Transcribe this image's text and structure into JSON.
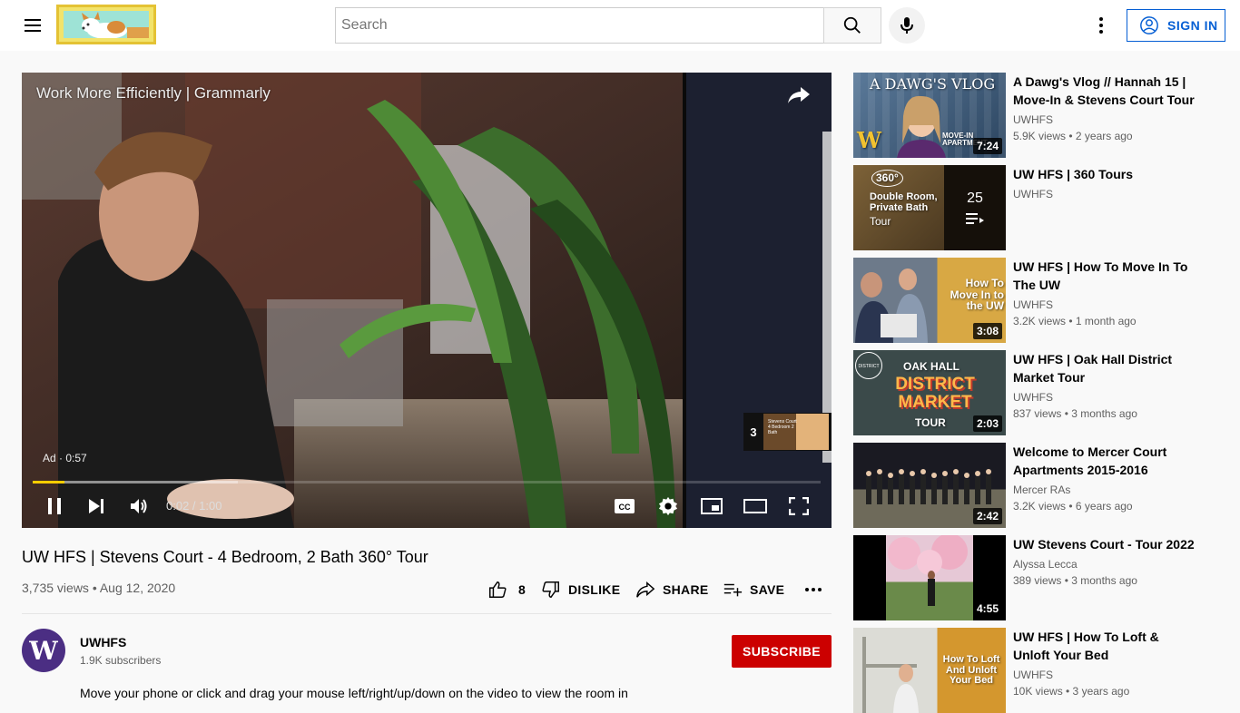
{
  "header": {
    "search_placeholder": "Search",
    "signin_label": "SIGN IN"
  },
  "player": {
    "ad_title": "Work More Efficiently | Grammarly",
    "ad_label": "Ad · 0:57",
    "time": "0:02 / 1:00",
    "next_card_number": "3",
    "next_card_thumb_text": "Stevens Court 4 Bedroom 2 Bath",
    "progress_played": 0.04,
    "progress_loaded": 0.26,
    "progress_color": "#ffcc00"
  },
  "video": {
    "title": "UW HFS | Stevens Court - 4 Bedroom, 2 Bath 360° Tour",
    "meta": "3,735 views • Aug 12, 2020",
    "likes": "8",
    "dislike_label": "DISLIKE",
    "share_label": "SHARE",
    "save_label": "SAVE"
  },
  "channel": {
    "avatar_letter": "W",
    "name": "UWHFS",
    "subscribers": "1.9K subscribers",
    "subscribe_label": "SUBSCRIBE",
    "accent": "#4b2e83"
  },
  "description": "Move your phone or click and drag your mouse left/right/up/down on the video to view the room in",
  "recommendations": [
    {
      "title": "A Dawg's Vlog // Hannah 15 | Move-In & Stevens Court Tour",
      "channel": "UWHFS",
      "stats": "5.9K views • 2 years ago",
      "duration": "7:24",
      "thumb_text": "A DAWG'S VLOG",
      "thumb_sub": "MOVE-IN APARTMENT"
    },
    {
      "title": "UW HFS | 360 Tours",
      "channel": "UWHFS",
      "stats": "",
      "duration": "",
      "thumb_text": "Double Room, Private Bath",
      "thumb_sub": "Tour",
      "badge": "360°",
      "playlist_count": "25"
    },
    {
      "title": "UW HFS | How To Move In To The UW",
      "channel": "UWHFS",
      "stats": "3.2K views • 1 month ago",
      "duration": "3:08",
      "thumb_text": "How To Move In to the UW",
      "thumb_sub": ""
    },
    {
      "title": "UW HFS | Oak Hall District Market Tour",
      "channel": "UWHFS",
      "stats": "837 views • 3 months ago",
      "duration": "2:03",
      "thumb_text": "DISTRICT MARKET",
      "thumb_sub": "OAK HALL",
      "thumb_sub2": "TOUR",
      "badge": "DISTRICT MARKET"
    },
    {
      "title": "Welcome to Mercer Court Apartments 2015-2016",
      "channel": "Mercer RAs",
      "stats": "3.2K views • 6 years ago",
      "duration": "2:42",
      "thumb_text": "",
      "thumb_sub": ""
    },
    {
      "title": "UW Stevens Court - Tour 2022",
      "channel": "Alyssa Lecca",
      "stats": "389 views • 3 months ago",
      "duration": "4:55",
      "thumb_text": "",
      "thumb_sub": ""
    },
    {
      "title": "UW HFS | How To Loft & Unloft Your Bed",
      "channel": "UWHFS",
      "stats": "10K views • 3 years ago",
      "duration": "",
      "thumb_text": "How To Loft And Unloft Your Bed",
      "thumb_sub": ""
    }
  ]
}
